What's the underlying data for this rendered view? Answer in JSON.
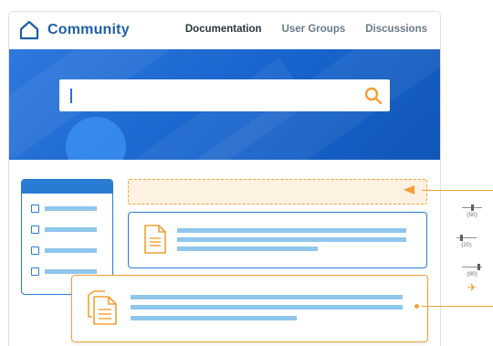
{
  "header": {
    "brand": "Community",
    "nav": [
      {
        "label": "Documentation",
        "active": true
      },
      {
        "label": "User Groups",
        "active": false
      },
      {
        "label": "Discussions",
        "active": false
      }
    ]
  },
  "search": {
    "value": "",
    "placeholder": ""
  },
  "zoom_sliders": [
    {
      "label": "(50)",
      "level": 50
    },
    {
      "label": "(20)",
      "level": 20
    },
    {
      "label": "(90)",
      "level": 90
    }
  ],
  "colors": {
    "brand_blue": "#1f5fa3",
    "hero_blue": "#1764cc",
    "accent_orange": "#f29f36",
    "line_blue": "#8fc6ec"
  },
  "icons": {
    "logo": "home-icon",
    "search": "search-icon",
    "card": "document-icon",
    "dragging": "copy-document-icon",
    "plane": "airplane-icon"
  }
}
